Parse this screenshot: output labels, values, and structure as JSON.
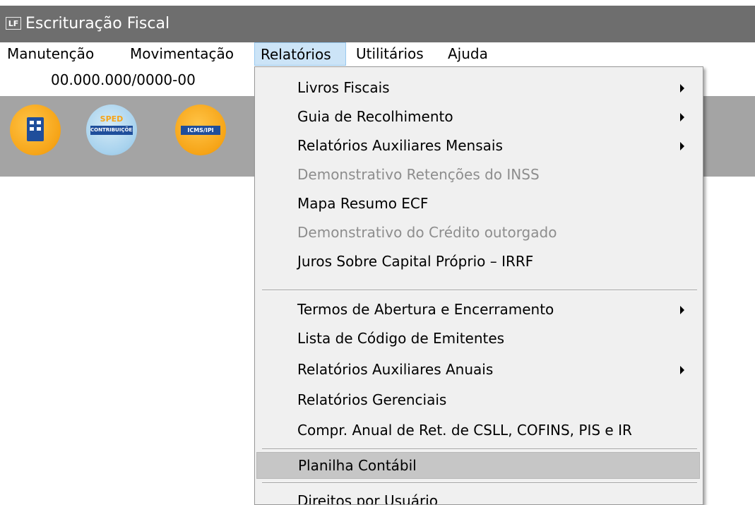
{
  "window": {
    "title": "Escrituração Fiscal",
    "app_icon_text": "LF"
  },
  "menubar": {
    "items": [
      {
        "label": "Manutenção"
      },
      {
        "label": "Movimentação"
      },
      {
        "label": "Relatórios",
        "active": true
      },
      {
        "label": "Utilitários"
      },
      {
        "label": "Ajuda"
      }
    ]
  },
  "company": {
    "cnpj": "00.000.000/0000-00"
  },
  "toolbar": {
    "buttons": [
      {
        "icon": "building-icon"
      },
      {
        "icon": "sped-contribuicoes-icon",
        "label_top": "SPED",
        "label_band": "CONTRIBUIÇÕES"
      },
      {
        "icon": "icms-ipi-icon",
        "label_band": "ICMS/IPI"
      }
    ]
  },
  "dropdown": {
    "items": [
      {
        "label": "Livros Fiscais",
        "submenu": true,
        "enabled": true
      },
      {
        "label": "Guia de Recolhimento",
        "submenu": true,
        "enabled": true
      },
      {
        "label": "Relatórios Auxiliares Mensais",
        "submenu": true,
        "enabled": true
      },
      {
        "label": "Demonstrativo Retenções do INSS",
        "submenu": false,
        "enabled": false
      },
      {
        "label": "Mapa Resumo ECF",
        "submenu": false,
        "enabled": true
      },
      {
        "label": "Demonstrativo do Crédito outorgado",
        "submenu": false,
        "enabled": false
      },
      {
        "label": "Juros Sobre Capital Próprio – IRRF",
        "submenu": false,
        "enabled": true
      },
      {
        "label": "Termos de Abertura e Encerramento",
        "submenu": true,
        "enabled": true
      },
      {
        "label": "Lista de Código de Emitentes",
        "submenu": false,
        "enabled": true
      },
      {
        "label": "Relatórios Auxiliares Anuais",
        "submenu": true,
        "enabled": true
      },
      {
        "label": "Relatórios Gerenciais",
        "submenu": false,
        "enabled": true
      },
      {
        "label": "Compr. Anual de Ret. de CSLL, COFINS,  PIS e IR",
        "submenu": false,
        "enabled": true
      },
      {
        "label": "Planilha Contábil",
        "submenu": false,
        "enabled": true,
        "highlighted": true
      },
      {
        "label": "Direitos por Usuário",
        "submenu": false,
        "enabled": true
      }
    ]
  }
}
